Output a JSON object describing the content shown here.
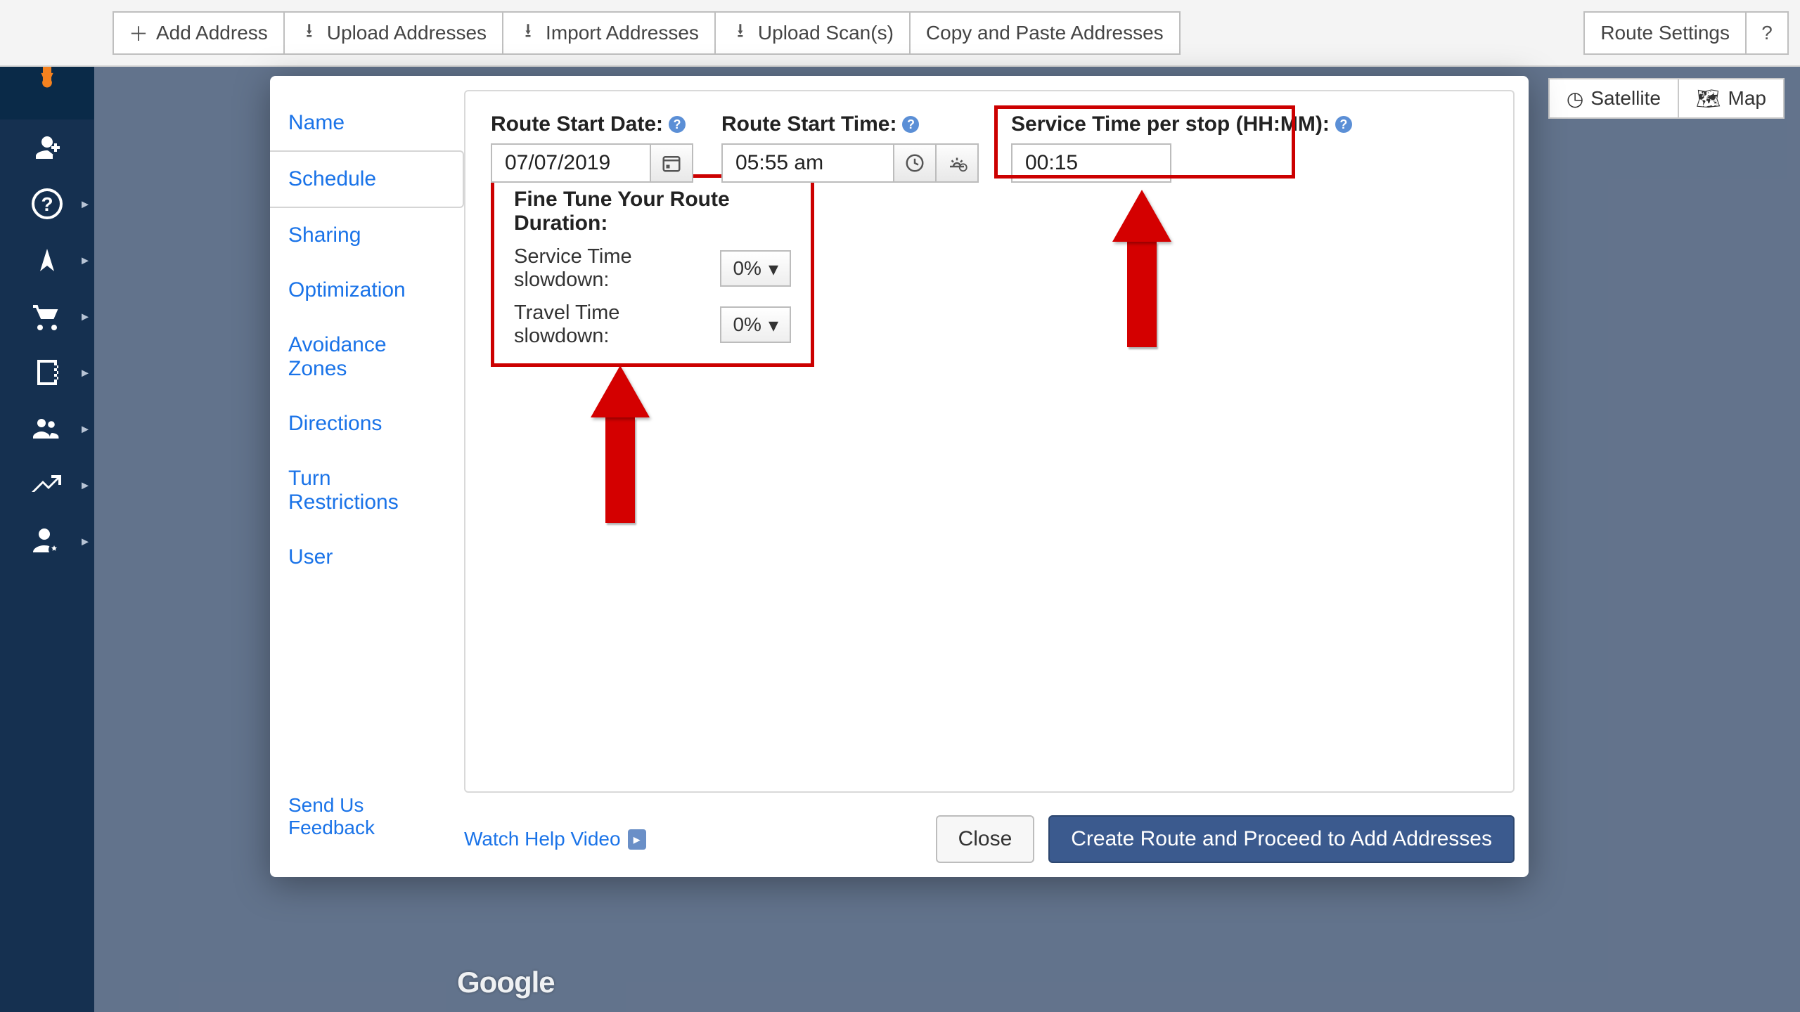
{
  "topbar": {
    "add_address": "Add Address",
    "upload_addresses": "Upload Addresses",
    "import_addresses": "Import Addresses",
    "upload_scans": "Upload Scan(s)",
    "copy_paste": "Copy and Paste Addresses",
    "route_settings": "Route Settings"
  },
  "map": {
    "satellite": "Satellite",
    "map": "Map",
    "google": "Google"
  },
  "modal": {
    "tabs": {
      "name": "Name",
      "schedule": "Schedule",
      "sharing": "Sharing",
      "optimization": "Optimization",
      "avoidance": "Avoidance Zones",
      "directions": "Directions",
      "turn": "Turn Restrictions",
      "user": "User"
    },
    "fields": {
      "start_date_label": "Route Start Date:",
      "start_date_value": "07/07/2019",
      "start_time_label": "Route Start Time:",
      "start_time_value": "05:55 am",
      "service_time_label": "Service Time per stop (HH:MM):",
      "service_time_value": "00:15"
    },
    "fine_tune": {
      "title": "Fine Tune Your Route Duration:",
      "service_slowdown_label": "Service Time slowdown:",
      "service_slowdown_value": "0%",
      "travel_slowdown_label": "Travel Time slowdown:",
      "travel_slowdown_value": "0%"
    },
    "footer": {
      "feedback": "Send Us Feedback",
      "help_video": "Watch Help Video",
      "close": "Close",
      "create": "Create Route and Proceed to Add Addresses"
    }
  }
}
